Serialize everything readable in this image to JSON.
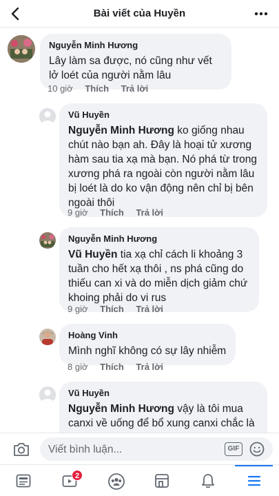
{
  "header": {
    "title": "Bài viết của Huyền"
  },
  "comments": [
    {
      "author": "Nguyễn Minh Hương",
      "tag": "",
      "text": "Lây làm sa được, nó cũng như vết lở loét của người nằm lâu",
      "time": "10 giờ",
      "like_label": "Thích",
      "reply_label": "Trả lời"
    },
    {
      "author": "Vũ Huyền",
      "tag": "Nguyễn Minh Hương",
      "text": " ko giống nhau chút nào bạn ah. Đây là hoại tử xương hàm sau tia xạ mà bạn. Nó phá từ trong xương phá ra ngoài còn người nằm lâu bị loét là do ko vận động nên chỉ bị bên ngoài thôi",
      "time": "9 giờ",
      "like_label": "Thích",
      "reply_label": "Trả lời"
    },
    {
      "author": "Nguyễn Minh Hương",
      "tag": "Vũ Huyền",
      "text": " tia xạ chỉ cách li khoảng 3 tuần cho hết xạ thôi , ns phá cũng do thiếu can xi và do miễn dịch giảm chứ khoing phải do vi rus",
      "time": "9 giờ",
      "like_label": "Thích",
      "reply_label": "Trả lời"
    },
    {
      "author": "Hoàng Vinh",
      "tag": "",
      "text": "Mình nghĩ không có sự lây nhiễm",
      "time": "8 giờ",
      "like_label": "Thích",
      "reply_label": "Trả lời"
    },
    {
      "author": "Vũ Huyền",
      "tag": "Nguyễn Minh Hương",
      "text": " vậy là tôi mua canxi về uống để bổ xung canxi chắc là được bạn nhỉ",
      "time": "",
      "like_label": "",
      "reply_label": ""
    }
  ],
  "composer": {
    "placeholder": "Viết bình luận...",
    "gif_label": "GIF"
  },
  "tabbar": {
    "video_badge": "2"
  },
  "colors": {
    "accent": "#1877f2",
    "badge": "#e41e3f",
    "bubble": "#f0f2f5"
  }
}
